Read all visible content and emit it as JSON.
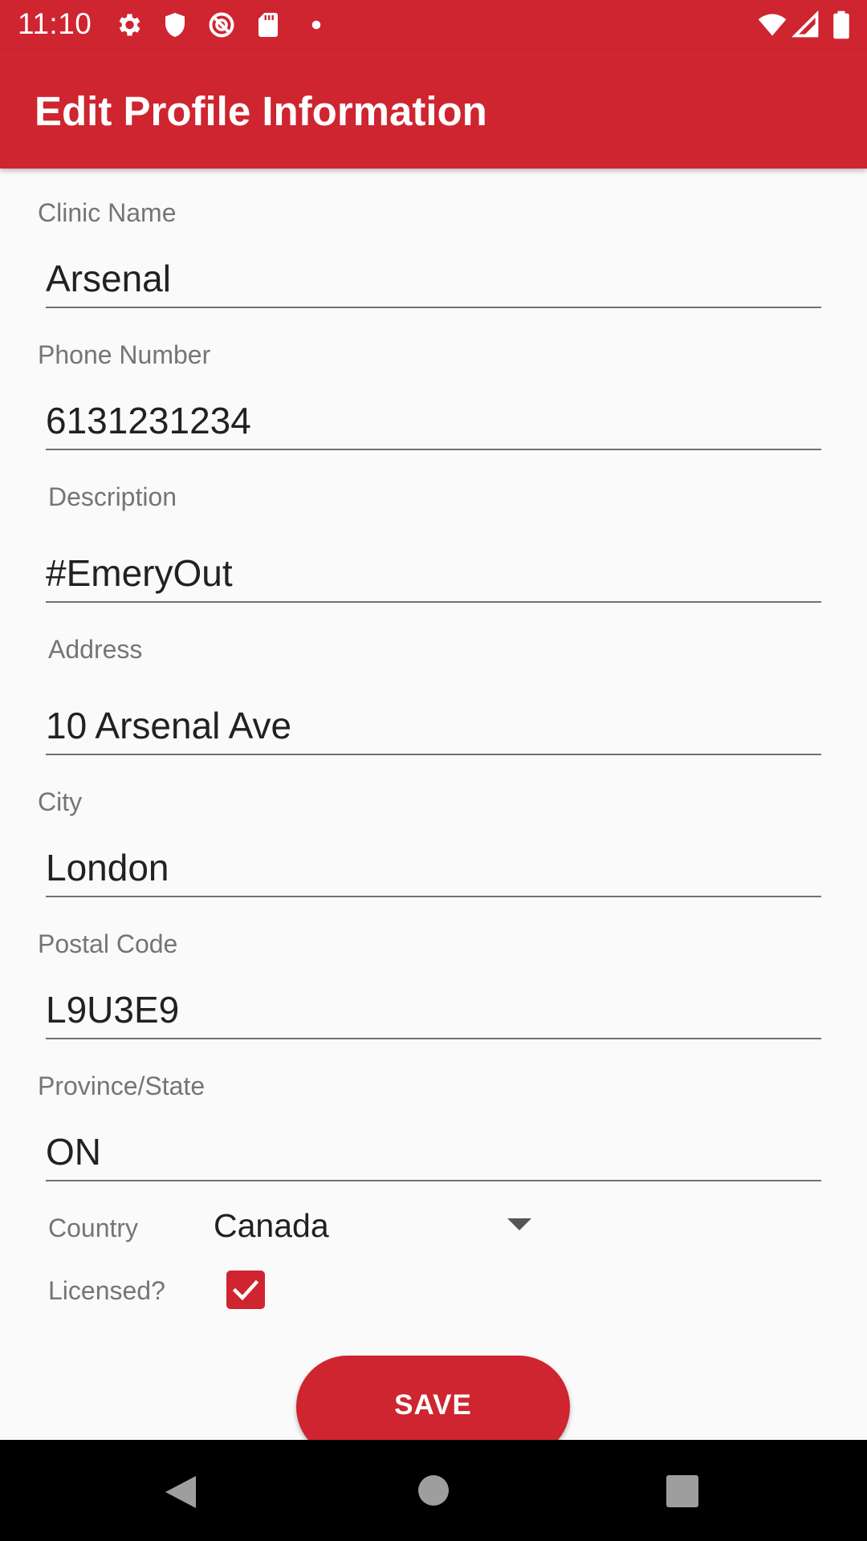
{
  "status_bar": {
    "time": "11:10",
    "left_icons": [
      "settings-icon",
      "shield-icon",
      "no-sync-icon",
      "sd-card-icon",
      "dot-icon"
    ],
    "right_icons": [
      "wifi-icon",
      "signal-icon",
      "battery-icon"
    ]
  },
  "app_bar": {
    "title": "Edit Profile Information"
  },
  "form": {
    "clinic_name": {
      "label": "Clinic Name",
      "value": "Arsenal"
    },
    "phone_number": {
      "label": "Phone Number",
      "value": "6131231234"
    },
    "description": {
      "label": "Description",
      "value": "#EmeryOut"
    },
    "address": {
      "label": "Address",
      "value": "10 Arsenal Ave"
    },
    "city": {
      "label": "City",
      "value": "London"
    },
    "postal_code": {
      "label": "Postal Code",
      "value": "L9U3E9"
    },
    "province_state": {
      "label": "Province/State",
      "value": "ON"
    },
    "country": {
      "label": "Country",
      "selected": "Canada"
    },
    "licensed": {
      "label": "Licensed?",
      "checked": true
    }
  },
  "save_button": {
    "label": "SAVE"
  },
  "colors": {
    "accent": "#ce2530",
    "background": "#fafafa",
    "label": "#757575",
    "text": "#212121"
  },
  "nav_bar": {
    "icons": [
      "back-icon",
      "home-icon",
      "recents-icon"
    ]
  }
}
